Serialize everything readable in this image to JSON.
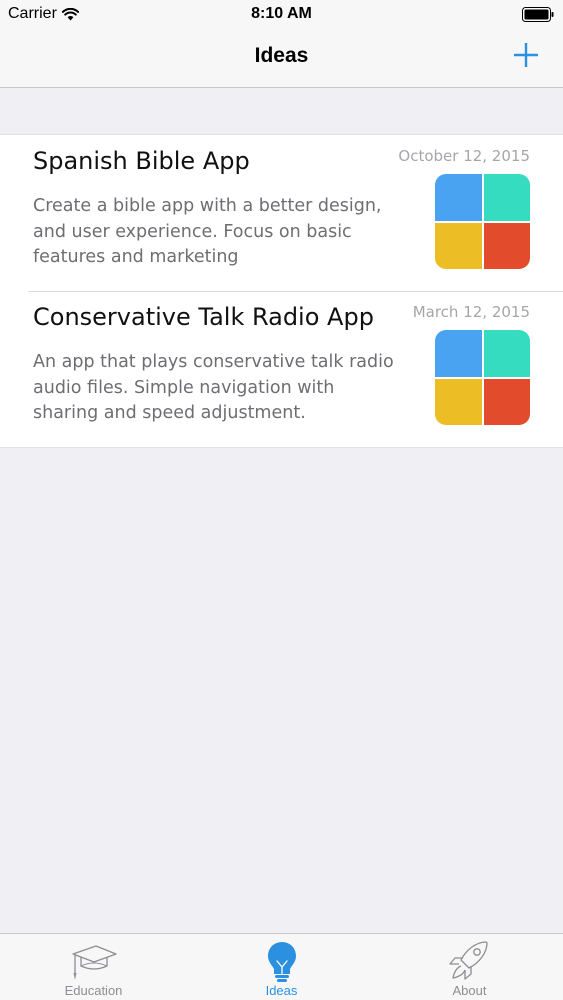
{
  "status_bar": {
    "carrier": "Carrier",
    "time": "8:10 AM"
  },
  "nav": {
    "title": "Ideas",
    "add_icon": "plus-icon"
  },
  "ideas": [
    {
      "title": "Spanish Bible App",
      "date": "October 12, 2015",
      "description": "Create a bible app with a better design, and user experience. Focus on basic features and marketing",
      "thumbnail_colors": [
        "#4aa3f0",
        "#35dcbf",
        "#ecbd24",
        "#e24b2c"
      ]
    },
    {
      "title": "Conservative Talk Radio App",
      "date": "March 12, 2015",
      "description": "An app that plays conservative talk radio audio files. Simple navigation with sharing and speed adjustment.",
      "thumbnail_colors": [
        "#4aa3f0",
        "#35dcbf",
        "#ecbd24",
        "#e24b2c"
      ]
    }
  ],
  "tabs": [
    {
      "label": "Education",
      "icon": "graduation-cap-icon",
      "active": false
    },
    {
      "label": "Ideas",
      "icon": "lightbulb-icon",
      "active": true
    },
    {
      "label": "About",
      "icon": "rocket-icon",
      "active": false
    }
  ],
  "colors": {
    "accent": "#2c90e0",
    "background": "#efeff4",
    "inactive_tab": "#8e8e93"
  }
}
